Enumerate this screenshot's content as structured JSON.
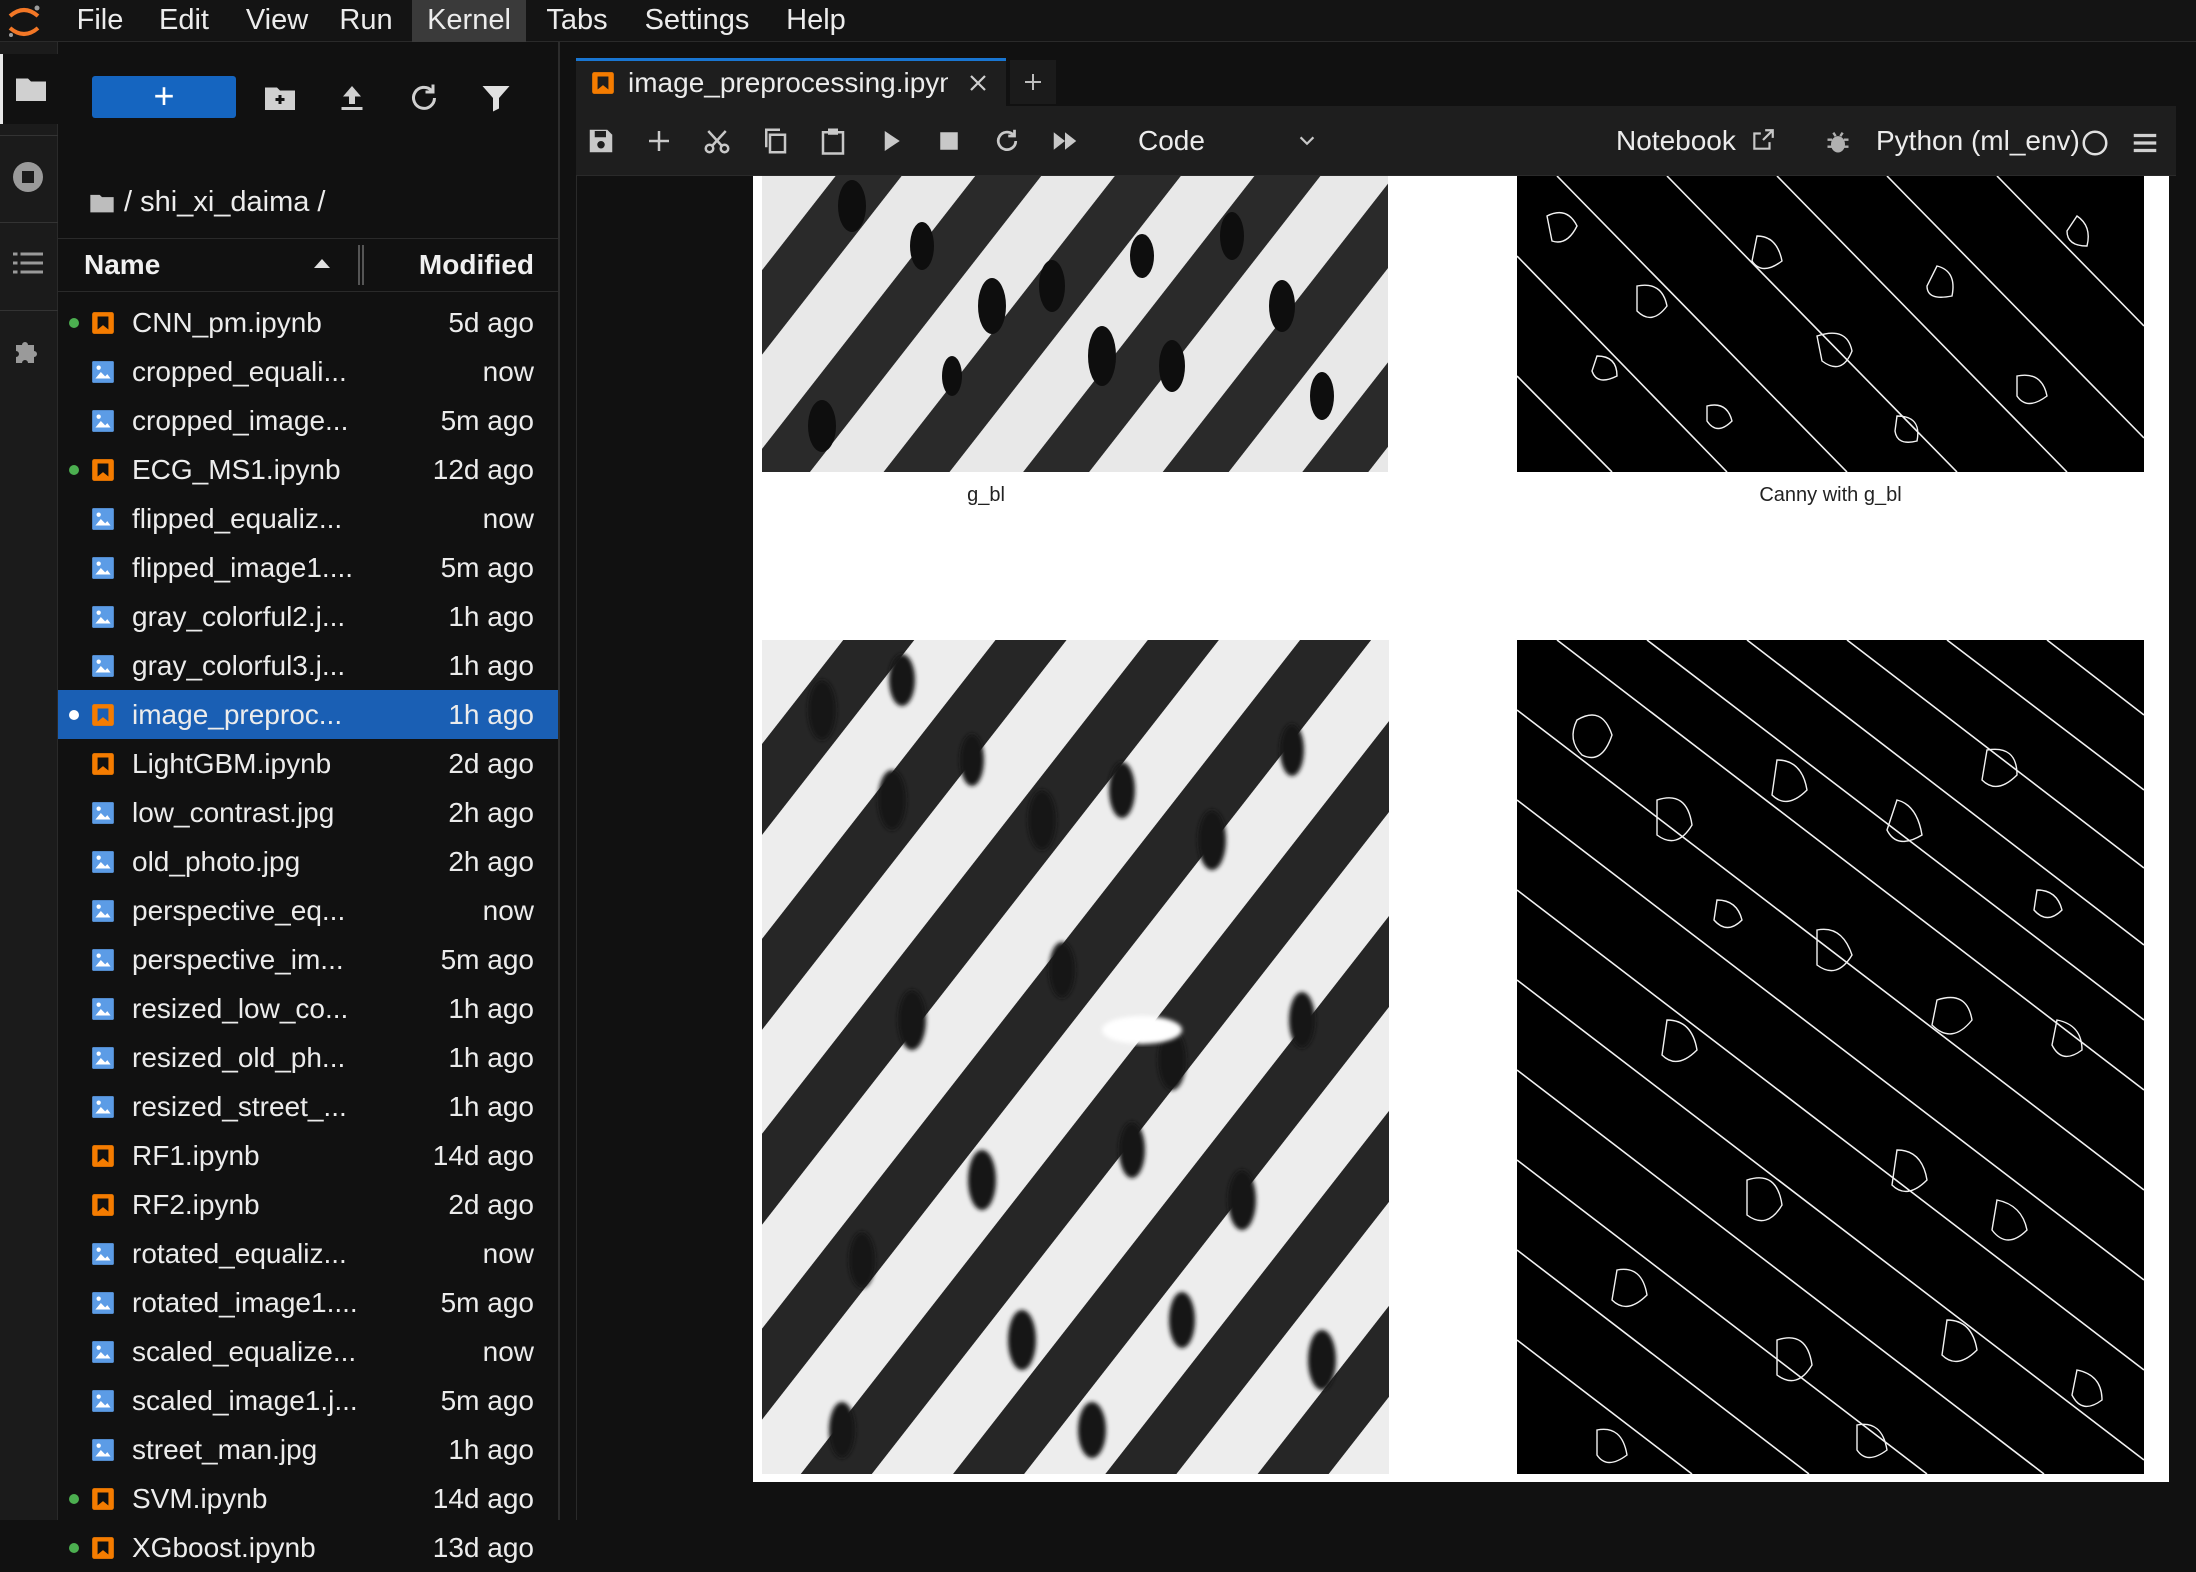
{
  "menu": {
    "items": [
      "File",
      "Edit",
      "View",
      "Run",
      "Kernel",
      "Tabs",
      "Settings",
      "Help"
    ],
    "active": "Kernel"
  },
  "filebrowser": {
    "new_button_label": "+",
    "breadcrumb": "/ shi_xi_daima /",
    "columns": {
      "name": "Name",
      "modified": "Modified"
    },
    "files": [
      {
        "name": "CNN_pm.ipynb",
        "modified": "5d ago",
        "type": "notebook",
        "running": true
      },
      {
        "name": "cropped_equali...",
        "modified": "now",
        "type": "image",
        "running": false
      },
      {
        "name": "cropped_image...",
        "modified": "5m ago",
        "type": "image",
        "running": false
      },
      {
        "name": "ECG_MS1.ipynb",
        "modified": "12d ago",
        "type": "notebook",
        "running": true
      },
      {
        "name": "flipped_equaliz...",
        "modified": "now",
        "type": "image",
        "running": false
      },
      {
        "name": "flipped_image1....",
        "modified": "5m ago",
        "type": "image",
        "running": false
      },
      {
        "name": "gray_colorful2.j...",
        "modified": "1h ago",
        "type": "image",
        "running": false
      },
      {
        "name": "gray_colorful3.j...",
        "modified": "1h ago",
        "type": "image",
        "running": false
      },
      {
        "name": "image_preproc...",
        "modified": "1h ago",
        "type": "notebook",
        "running": true,
        "selected": true
      },
      {
        "name": "LightGBM.ipynb",
        "modified": "2d ago",
        "type": "notebook",
        "running": false
      },
      {
        "name": "low_contrast.jpg",
        "modified": "2h ago",
        "type": "image",
        "running": false
      },
      {
        "name": "old_photo.jpg",
        "modified": "2h ago",
        "type": "image",
        "running": false
      },
      {
        "name": "perspective_eq...",
        "modified": "now",
        "type": "image",
        "running": false
      },
      {
        "name": "perspective_im...",
        "modified": "5m ago",
        "type": "image",
        "running": false
      },
      {
        "name": "resized_low_co...",
        "modified": "1h ago",
        "type": "image",
        "running": false
      },
      {
        "name": "resized_old_ph...",
        "modified": "1h ago",
        "type": "image",
        "running": false
      },
      {
        "name": "resized_street_...",
        "modified": "1h ago",
        "type": "image",
        "running": false
      },
      {
        "name": "RF1.ipynb",
        "modified": "14d ago",
        "type": "notebook",
        "running": false
      },
      {
        "name": "RF2.ipynb",
        "modified": "2d ago",
        "type": "notebook",
        "running": false
      },
      {
        "name": "rotated_equaliz...",
        "modified": "now",
        "type": "image",
        "running": false
      },
      {
        "name": "rotated_image1....",
        "modified": "5m ago",
        "type": "image",
        "running": false
      },
      {
        "name": "scaled_equalize...",
        "modified": "now",
        "type": "image",
        "running": false
      },
      {
        "name": "scaled_image1.j...",
        "modified": "5m ago",
        "type": "image",
        "running": false
      },
      {
        "name": "street_man.jpg",
        "modified": "1h ago",
        "type": "image",
        "running": false
      },
      {
        "name": "SVM.ipynb",
        "modified": "14d ago",
        "type": "notebook",
        "running": true
      },
      {
        "name": "XGboost.ipynb",
        "modified": "13d ago",
        "type": "notebook",
        "running": true
      }
    ]
  },
  "tab": {
    "label": "image_preprocessing.ipynb"
  },
  "toolbar": {
    "cell_type": "Code",
    "notebook_label": "Notebook",
    "kernel_label": "Python (ml_env)"
  },
  "output": {
    "titles": {
      "left": "g_bl",
      "right": "Canny with g_bl"
    }
  },
  "colors": {
    "accent": "#1976d2",
    "selected_row": "#1a5fb4",
    "notebook_icon": "#f57c00",
    "image_icon": "#5c9ce6",
    "running_dot": "#4caf50"
  },
  "icons": {
    "logo": "jupyter-logo-icon",
    "activity": [
      "folder-icon",
      "running-icon",
      "toc-icon",
      "extension-icon"
    ],
    "filebrowser_tools": [
      "new-folder-icon",
      "upload-icon",
      "refresh-icon",
      "filter-icon"
    ],
    "toolbar": [
      "save-icon",
      "add-cell-icon",
      "cut-icon",
      "copy-icon",
      "paste-icon",
      "run-icon",
      "stop-icon",
      "restart-icon",
      "fast-forward-icon"
    ]
  }
}
